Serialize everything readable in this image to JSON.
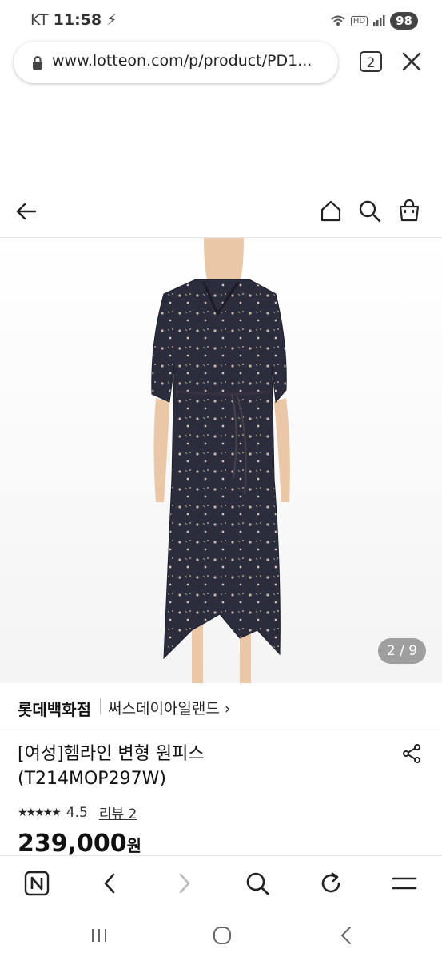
{
  "status_bar": {
    "carrier": "KT",
    "time": "11:58",
    "network": "HD",
    "battery": "98"
  },
  "browser": {
    "url": "www.lotteon.com/p/product/PD1...",
    "tab_count": "2"
  },
  "product": {
    "image_counter": "2 / 9",
    "store": "롯데백화점",
    "brand": "써스데이아일랜드 ›",
    "title_line1": "[여성]헴라인 변형 원피스",
    "title_line2": "(T214MOP297W)",
    "stars": "★★★★★",
    "rating": "4.5",
    "reviews": "리뷰 2",
    "price": "239,000",
    "currency": "원"
  },
  "icons": {
    "site_header": [
      "back-arrow-icon",
      "home-icon",
      "search-icon",
      "shopping-bag-icon"
    ],
    "toolbar": [
      "naver-icon",
      "back-icon",
      "forward-icon",
      "search-icon",
      "refresh-icon",
      "menu-icon"
    ],
    "system_nav": [
      "recent-apps-icon",
      "home-icon",
      "back-icon"
    ]
  },
  "colors": {
    "dress": "#2b2d3c",
    "text": "#111111",
    "counter_bg": "#8a8a8a"
  }
}
